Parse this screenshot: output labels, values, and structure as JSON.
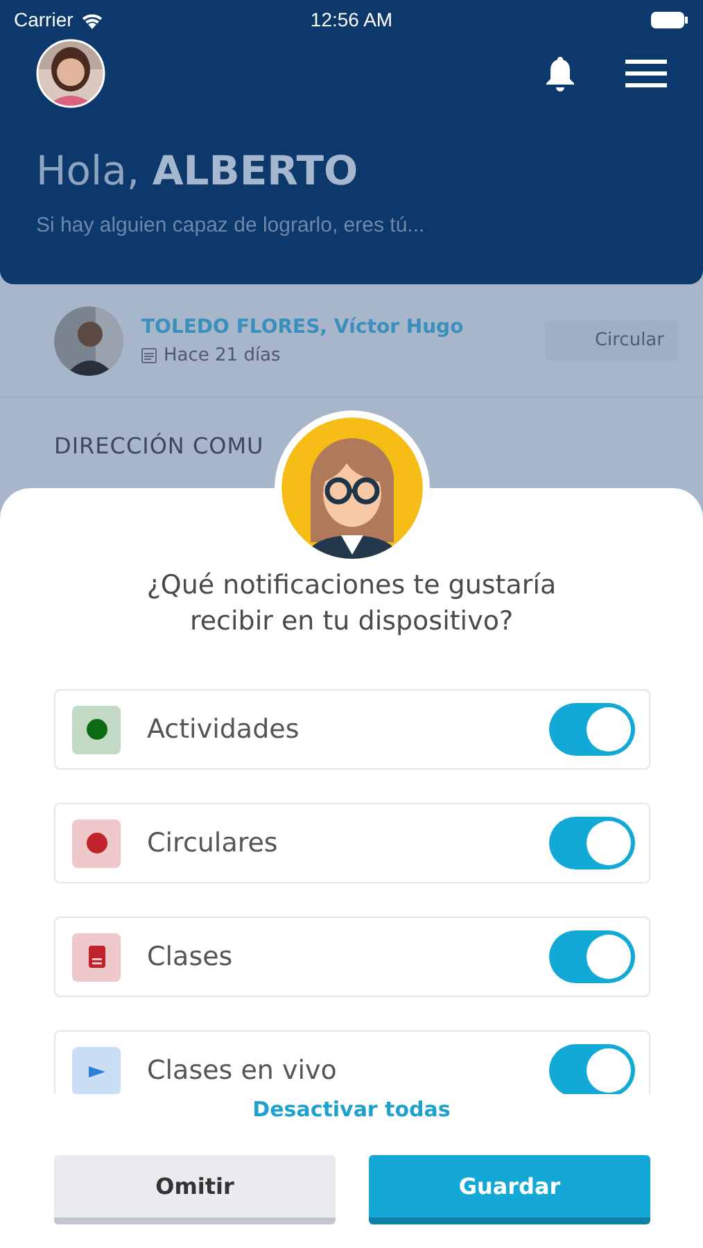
{
  "status_bar": {
    "carrier": "Carrier",
    "time": "12:56 AM"
  },
  "header": {
    "greeting": "Hola, **ALBERTO**",
    "subtitle": "Si hay alguien capaz de lograrlo, eres tú..."
  },
  "post": {
    "author": "TOLEDO FLORES, Víctor Hugo",
    "date": "Hace 21 días",
    "tag": "Circular",
    "section": "DIRECCIÓN COMU"
  },
  "dialog": {
    "title": "¿Qué notificaciones te gustaría recibir en tu dispositivo?",
    "notifications": [
      {
        "label": "Actividades",
        "kind": "dot",
        "color": "#0b6b14",
        "on": true
      },
      {
        "label": "Circulares",
        "kind": "dot",
        "color": "#c1232b",
        "on": true
      },
      {
        "label": "Clases",
        "kind": "book",
        "color": "#c1232b",
        "on": true
      },
      {
        "label": "Clases en vivo",
        "kind": "video",
        "color": "#2b7fd8",
        "on": true
      }
    ],
    "link": "Desactivar todas",
    "buttons": [
      {
        "label": "Omitir",
        "kind": "secondary"
      },
      {
        "label": "Guardar",
        "kind": "primary"
      }
    ]
  }
}
